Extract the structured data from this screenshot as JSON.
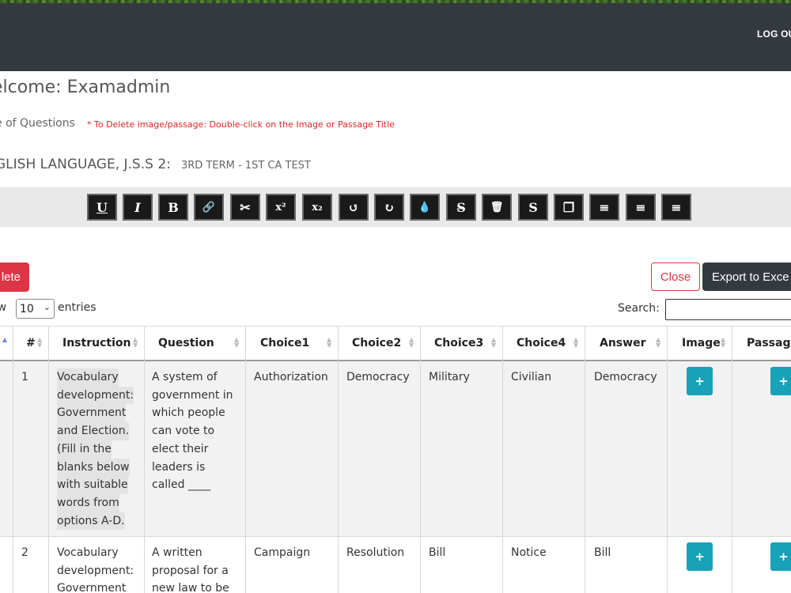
{
  "header": {
    "logout_label": "LOG OU"
  },
  "welcome": "elcome: Examadmin",
  "questions_label": "e of Questions",
  "delete_note": "* To Delete image/passage: Double-click on the Image or Passage Title",
  "subject": "GLISH LANGUAGE, J.S.S 2:",
  "term": "3RD TERM - 1ST CA TEST",
  "toolbar": [
    {
      "name": "underline",
      "glyph": "U"
    },
    {
      "name": "italic",
      "glyph": "I"
    },
    {
      "name": "bold",
      "glyph": "B"
    },
    {
      "name": "link",
      "glyph": "🔗"
    },
    {
      "name": "cut",
      "glyph": "✂"
    },
    {
      "name": "superscript",
      "glyph": "x²"
    },
    {
      "name": "subscript",
      "glyph": "x₂"
    },
    {
      "name": "undo",
      "glyph": "↺"
    },
    {
      "name": "redo",
      "glyph": "↻"
    },
    {
      "name": "color",
      "glyph": "💧"
    },
    {
      "name": "strikethrough",
      "glyph": "S̶"
    },
    {
      "name": "delete",
      "glyph": "🗑"
    },
    {
      "name": "remove-format",
      "glyph": "S"
    },
    {
      "name": "copy",
      "glyph": "❐"
    },
    {
      "name": "align-center",
      "glyph": "≡"
    },
    {
      "name": "align-left",
      "glyph": "≡"
    },
    {
      "name": "align-right",
      "glyph": "≡"
    }
  ],
  "buttons": {
    "delete": "lete",
    "close": "Close",
    "export": "Export to Exce"
  },
  "length": {
    "show": "ow",
    "value": "10",
    "entries": "entries"
  },
  "search": {
    "label": "Search:",
    "value": ""
  },
  "columns": [
    "#",
    "Instruction",
    "Question",
    "Choice1",
    "Choice2",
    "Choice3",
    "Choice4",
    "Answer",
    "Image",
    "Passage"
  ],
  "rows": [
    {
      "num": "1",
      "instruction": [
        "Vocabulary",
        "development:",
        "Government",
        "and Election.",
        "(Fill in the",
        "blanks below",
        "with suitable",
        "words from",
        "options A-D."
      ],
      "question": [
        "A system of",
        "government in",
        "which people",
        "can vote to",
        "elect their",
        "leaders is",
        "called ____"
      ],
      "choice1": "Authorization",
      "choice2": "Democracy",
      "choice3": "Military",
      "choice4": "Civilian",
      "answer": "Democracy",
      "image_btn": "+",
      "passage_btn": "+"
    },
    {
      "num": "2",
      "instruction": [
        "Vocabulary",
        "development:",
        "Government"
      ],
      "question": [
        "A written",
        "proposal for a",
        "new law to be"
      ],
      "choice1": "Campaign",
      "choice2": "Resolution",
      "choice3": "Bill",
      "choice4": "Notice",
      "answer": "Bill",
      "image_btn": "+",
      "passage_btn": "+"
    }
  ]
}
